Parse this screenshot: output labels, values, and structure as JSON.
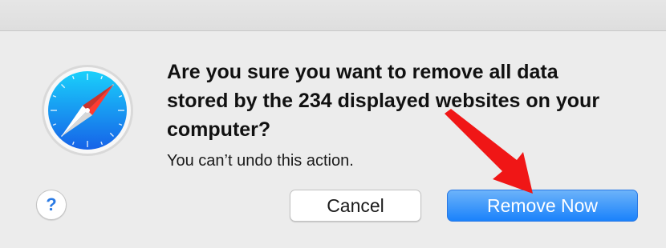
{
  "dialog": {
    "headline": "Are you sure you want to remove all data stored by the 234 displayed websites on your computer?",
    "subtext": "You can’t undo this action.",
    "help_label": "?",
    "cancel_label": "Cancel",
    "remove_label": "Remove Now",
    "app_icon": "safari-compass-icon"
  },
  "colors": {
    "accent": "#1a82fb",
    "annotation_arrow": "#f01616",
    "background": "#ececec"
  }
}
